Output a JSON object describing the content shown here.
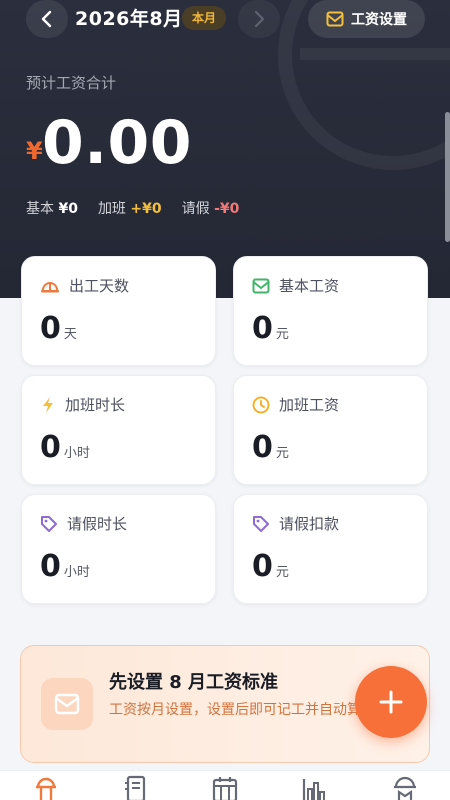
{
  "header": {
    "month_title": "2026年8月",
    "current_badge": "本月",
    "settings_label": "工资设置"
  },
  "summary": {
    "label": "预计工资合计",
    "currency": "¥",
    "amount": "0.00",
    "base_label": "基本",
    "base_value": "¥0",
    "overtime_label": "加班",
    "overtime_value": "+¥0",
    "leave_label": "请假",
    "leave_value": "-¥0"
  },
  "cards": [
    {
      "label": "出工天数",
      "value": "0",
      "unit": "天",
      "icon": "hardhat-icon"
    },
    {
      "label": "基本工资",
      "value": "0",
      "unit": "元",
      "icon": "wallet-icon"
    },
    {
      "label": "加班时长",
      "value": "0",
      "unit": "小时",
      "icon": "lightning-icon"
    },
    {
      "label": "加班工资",
      "value": "0",
      "unit": "元",
      "icon": "clock-icon"
    },
    {
      "label": "请假时长",
      "value": "0",
      "unit": "小时",
      "icon": "tag-icon"
    },
    {
      "label": "请假扣款",
      "value": "0",
      "unit": "元",
      "icon": "tag-icon"
    }
  ],
  "promo": {
    "title": "先设置 8 月工资标准",
    "description": "工资按月设置，设置后即可记工并自动算工资"
  },
  "colors": {
    "header_bg": "#2b2f3d",
    "accent_orange": "#f7703a",
    "overtime_yellow": "#f4bf3b",
    "leave_red": "#f27878",
    "card_bg": "#ffffff"
  },
  "tabs": [
    "hardhat-tab-icon",
    "ledger-tab-icon",
    "calendar-tab-icon",
    "chart-tab-icon",
    "profile-tab-icon"
  ]
}
